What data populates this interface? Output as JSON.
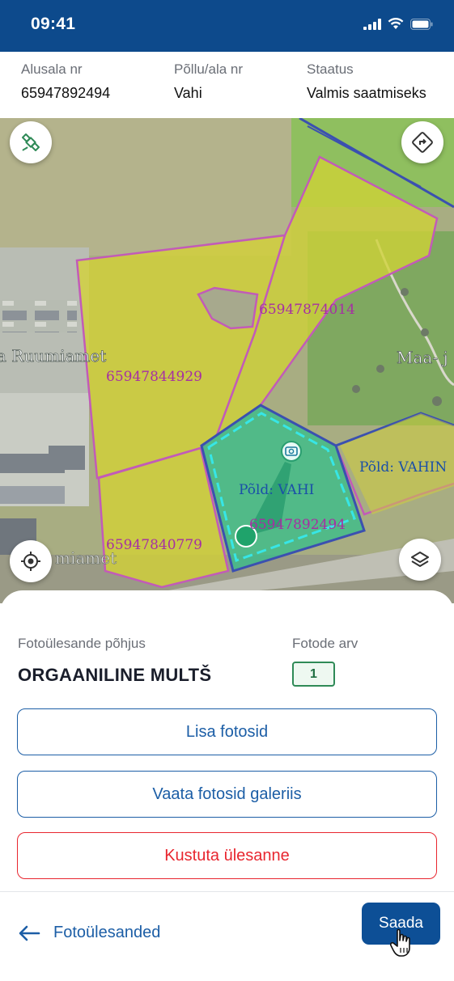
{
  "status_bar": {
    "time": "09:41"
  },
  "header": {
    "col1": {
      "label": "Alusala nr",
      "value": "65947892494"
    },
    "col2": {
      "label": "Põllu/ala nr",
      "value": "Vahi"
    },
    "col3": {
      "label": "Staatus",
      "value": "Valmis saatmiseks"
    }
  },
  "map": {
    "place_labels": [
      "a Ruumiamet",
      "Maa- j",
      "miamet"
    ],
    "parcel_ids": [
      "65947874014",
      "65947844929",
      "65947840779",
      "65947892494"
    ],
    "field_labels": [
      "Põld: VAHI",
      "Põld: VAHIN"
    ]
  },
  "sheet": {
    "reason_label": "Fotoülesande põhjus",
    "reason_value": "ORGAANILINE MULTŠ",
    "count_label": "Fotode arv",
    "count_value": "1",
    "add_photos": "Lisa fotosid",
    "view_gallery": "Vaata fotosid galeriis",
    "delete_task": "Kustuta ülesanne",
    "back_label": "Fotoülesanded",
    "send_label": "Saada"
  },
  "colors": {
    "primary": "#0d4a8c",
    "button_blue": "#1c5ea6",
    "danger": "#e8262f",
    "badge_green": "#2f8a57",
    "parcel_outline": "#c25bb8",
    "selected_parcel": "#2fbf8a"
  },
  "icons": [
    "signal-icon",
    "wifi-icon",
    "battery-icon",
    "satellite-icon",
    "directions-icon",
    "locate-icon",
    "layers-icon",
    "camera-icon",
    "arrow-left-icon",
    "hand-cursor-icon"
  ]
}
